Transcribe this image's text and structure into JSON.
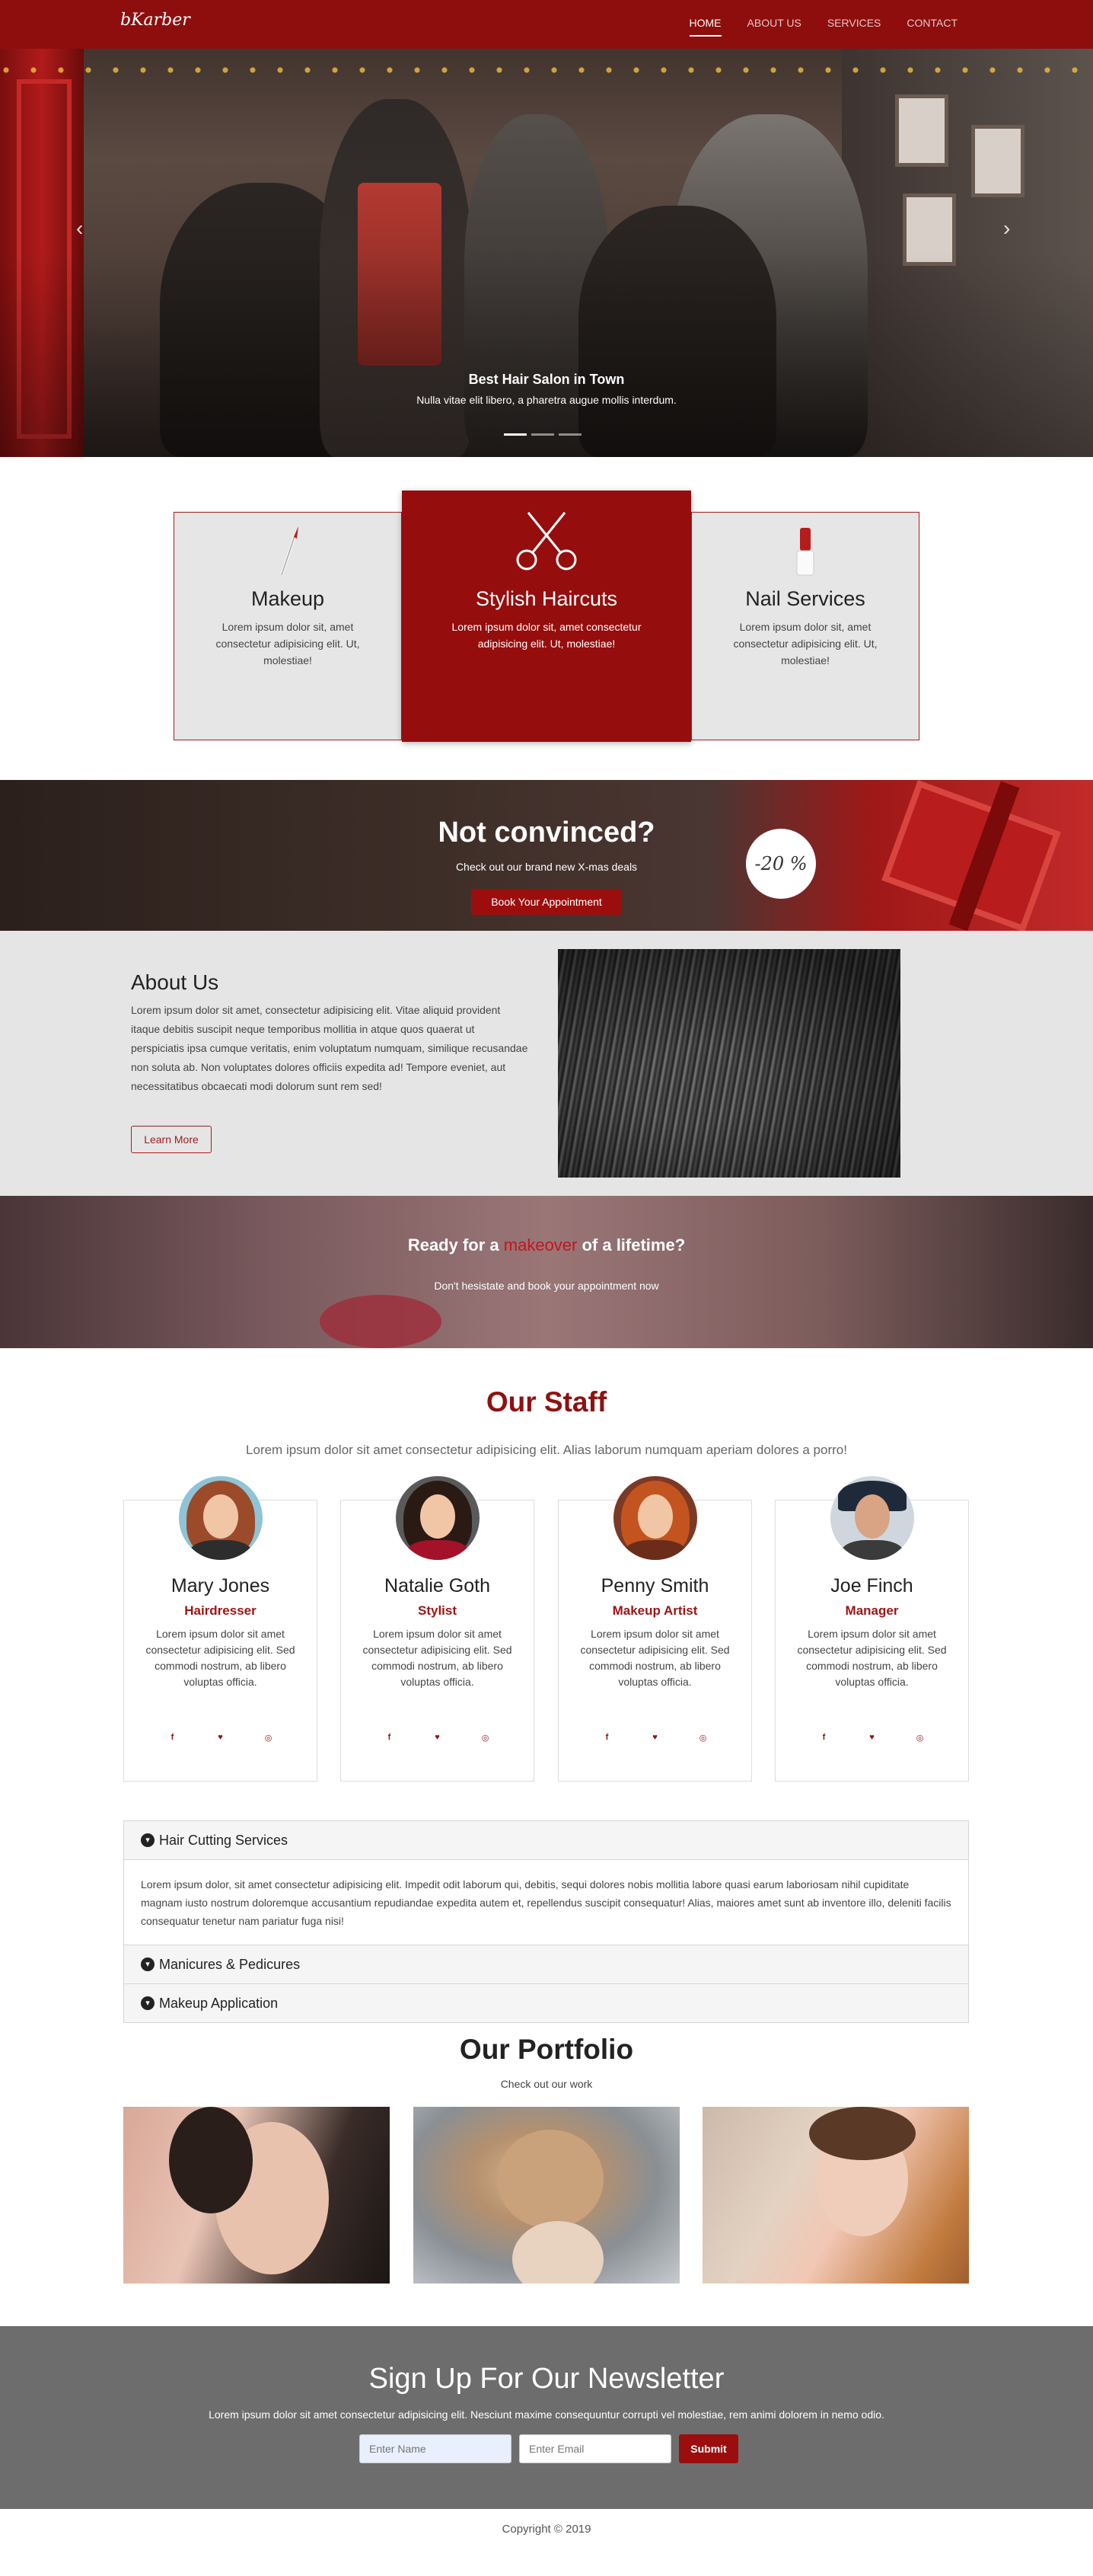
{
  "nav": {
    "logo": "bKarber",
    "links": [
      {
        "label": "HOME",
        "active": true
      },
      {
        "label": "ABOUT US",
        "active": false
      },
      {
        "label": "SERVICES",
        "active": false
      },
      {
        "label": "CONTACT",
        "active": false
      }
    ]
  },
  "hero": {
    "title": "Best Hair Salon in Town",
    "text": "Nulla vitae elit libero, a pharetra augue mollis interdum.",
    "slides": 3,
    "active_slide": 0
  },
  "services": [
    {
      "title": "Makeup",
      "text": "Lorem ipsum dolor sit, amet consectetur adipisicing elit. Ut, molestiae!",
      "icon": "brush-icon"
    },
    {
      "title": "Stylish Haircuts",
      "text": "Lorem ipsum dolor sit, amet consectetur adipisicing elit. Ut, molestiae!",
      "icon": "scissors-icon"
    },
    {
      "title": "Nail Services",
      "text": "Lorem ipsum dolor sit, amet consectetur adipisicing elit. Ut, molestiae!",
      "icon": "nail-polish-icon"
    }
  ],
  "promo": {
    "title": "Not convinced?",
    "text": "Check out our brand new X-mas deals",
    "button": "Book Your Appointment",
    "badge": "-20 %"
  },
  "about": {
    "title": "About Us",
    "text": "Lorem ipsum dolor sit amet, consectetur adipisicing elit. Vitae aliquid provident itaque debitis suscipit neque temporibus mollitia in atque quos quaerat ut perspiciatis ipsa cumque veritatis, enim voluptatum numquam, similique recusandae non soluta ab. Non voluptates dolores officiis expedita ad! Tempore eveniet, aut necessitatibus obcaecati modi dolorum sunt rem sed!",
    "button": "Learn More"
  },
  "makeover": {
    "title_before": "Ready for a ",
    "title_accent": "makeover",
    "title_after": " of a lifetime?",
    "text": "Don't hesistate and book your appointment now"
  },
  "staff": {
    "title": "Our Staff",
    "subtitle": "Lorem ipsum dolor sit amet consectetur adipisicing elit. Alias laborum numquam aperiam dolores a porro!",
    "members": [
      {
        "name": "Mary Jones",
        "role": "Hairdresser",
        "text": "Lorem ipsum dolor sit amet consectetur adipisicing elit. Sed commodi nostrum, ab libero voluptas officia."
      },
      {
        "name": "Natalie Goth",
        "role": "Stylist",
        "text": "Lorem ipsum dolor sit amet consectetur adipisicing elit. Sed commodi nostrum, ab libero voluptas officia."
      },
      {
        "name": "Penny Smith",
        "role": "Makeup Artist",
        "text": "Lorem ipsum dolor sit amet consectetur adipisicing elit. Sed commodi nostrum, ab libero voluptas officia."
      },
      {
        "name": "Joe Finch",
        "role": "Manager",
        "text": "Lorem ipsum dolor sit amet consectetur adipisicing elit. Sed commodi nostrum, ab libero voluptas officia."
      }
    ],
    "social_icons": [
      "facebook-icon",
      "twitter-icon",
      "instagram-icon"
    ]
  },
  "accordion": [
    {
      "title": "Hair Cutting Services",
      "open": true,
      "body": "Lorem ipsum dolor, sit amet consectetur adipisicing elit. Impedit odit laborum qui, debitis, sequi dolores nobis mollitia labore quasi earum laboriosam nihil cupiditate magnam iusto nostrum doloremque accusantium repudiandae expedita autem et, repellendus suscipit consequatur! Alias, maiores amet sunt ab inventore illo, deleniti facilis consequatur tenetur nam pariatur fuga nisi!"
    },
    {
      "title": "Manicures & Pedicures",
      "open": false
    },
    {
      "title": "Makeup Application",
      "open": false
    }
  ],
  "portfolio": {
    "title": "Our Portfolio",
    "subtitle": "Check out our work"
  },
  "newsletter": {
    "title": "Sign Up For Our Newsletter",
    "text": "Lorem ipsum dolor sit amet consectetur adipisicing elit. Nesciunt maxime consequuntur corrupti vel molestiae, rem animi dolorem in nemo odio.",
    "name_placeholder": "Enter Name",
    "email_placeholder": "Enter Email",
    "submit": "Submit"
  },
  "footer": {
    "copyright": "Copyright © 2019"
  }
}
